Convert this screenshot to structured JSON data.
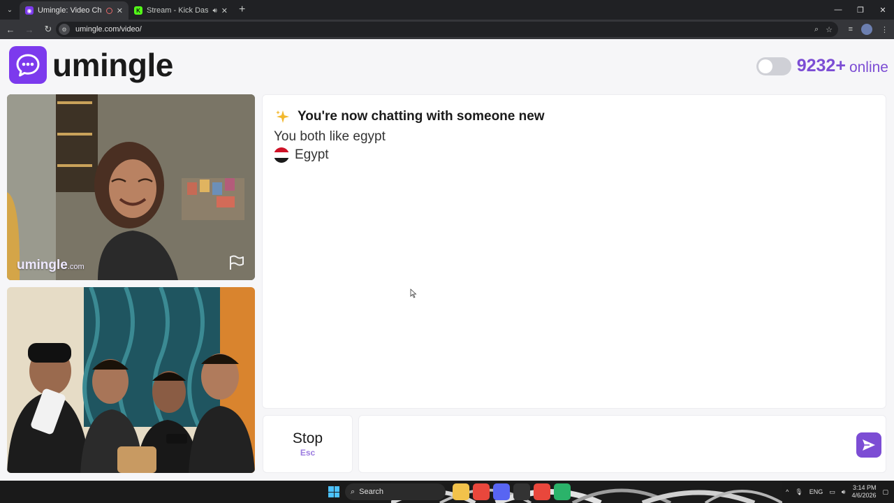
{
  "browser": {
    "tabs": [
      {
        "title": "Umingle: Video Chat with S",
        "active": true
      },
      {
        "title": "Stream - Kick Dashboard",
        "active": false
      }
    ],
    "url": "umingle.com/video/"
  },
  "header": {
    "brand": "umingle",
    "online_count": "9232+",
    "online_label": "online"
  },
  "stranger_video": {
    "watermark_main": "umingle",
    "watermark_suffix": ".com"
  },
  "chat": {
    "intro": "You're now chatting with someone new",
    "shared_interest": "You both like egypt",
    "country": "Egypt"
  },
  "controls": {
    "stop_label": "Stop",
    "stop_shortcut": "Esc",
    "message_placeholder": ""
  },
  "taskbar": {
    "search_label": "Search",
    "language": "ENG",
    "time": "3:14 PM",
    "date": "4/6/2026"
  },
  "colors": {
    "brand": "#7c3aed",
    "accent": "#7c4dd4"
  }
}
